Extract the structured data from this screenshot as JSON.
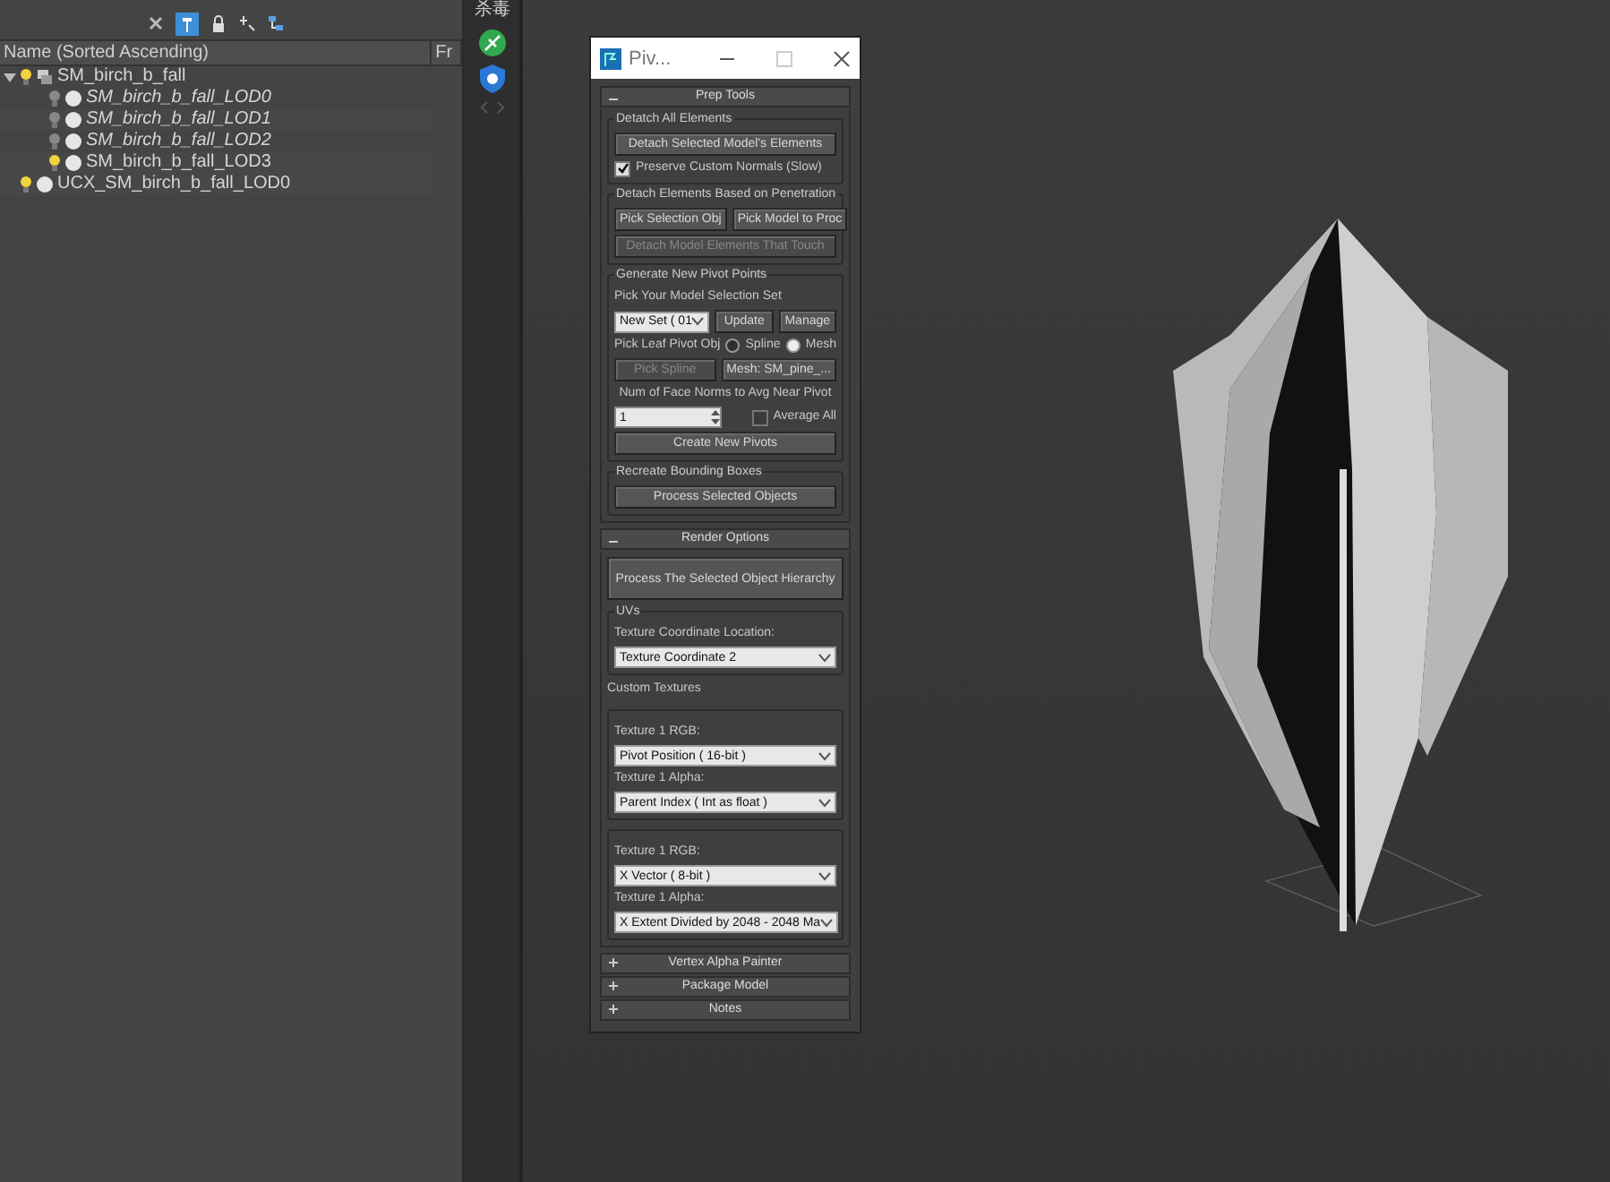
{
  "explorer": {
    "columns": [
      "Name (Sorted Ascending)",
      "Fr"
    ],
    "tree": [
      {
        "name": "SM_birch_b_fall",
        "hidden": false,
        "expanded": true,
        "children": [
          {
            "name": "SM_birch_b_fall_LOD0",
            "hidden": true
          },
          {
            "name": "SM_birch_b_fall_LOD1",
            "hidden": true
          },
          {
            "name": "SM_birch_b_fall_LOD2",
            "hidden": true
          },
          {
            "name": "SM_birch_b_fall_LOD3",
            "hidden": false
          }
        ]
      },
      {
        "name": "UCX_SM_birch_b_fall_LOD0",
        "hidden": false
      }
    ]
  },
  "side_strip": {
    "label": "杀毒"
  },
  "pivot_window": {
    "title": "Piv...",
    "rollouts": [
      {
        "title": "Prep Tools",
        "expanded": true,
        "blocks": [
          {
            "kind": "group",
            "title": "Detatch All Elements",
            "rows": [
              [
                {
                  "kind": "button",
                  "text": "Detach Selected Model's Elements"
                }
              ],
              [
                {
                  "kind": "checkbox",
                  "text": "Preserve Custom Normals (Slow)",
                  "checked": true
                }
              ]
            ]
          },
          {
            "kind": "group",
            "title": "Detach Elements Based on Penetration",
            "rows": [
              [
                {
                  "kind": "button",
                  "text": "Pick Selection Obj"
                },
                {
                  "kind": "button",
                  "text": "Pick Model to Proc"
                }
              ],
              [
                {
                  "kind": "button",
                  "text": "Detach Model Elements That Touch",
                  "disabled": true
                }
              ]
            ]
          },
          {
            "kind": "group",
            "title": "Generate New Pivot Points",
            "rows": [
              [
                {
                  "kind": "label",
                  "text": "Pick Your Model Selection Set"
                }
              ],
              [
                {
                  "kind": "dropdown",
                  "text": "New Set ( 01"
                },
                {
                  "kind": "button",
                  "text": "Update"
                },
                {
                  "kind": "button",
                  "text": "Manage"
                }
              ],
              [
                {
                  "kind": "label",
                  "text": "Pick Leaf Pivot Obj"
                },
                {
                  "kind": "radio",
                  "text": "Spline",
                  "selected": false
                },
                {
                  "kind": "radio",
                  "text": "Mesh",
                  "selected": true
                }
              ],
              [
                {
                  "kind": "button",
                  "text": "Pick Spline",
                  "disabled": true
                },
                {
                  "kind": "button",
                  "text": "Mesh: SM_pine_..."
                }
              ],
              [
                {
                  "kind": "label",
                  "text": "Num of Face Norms to Avg Near Pivot"
                }
              ],
              [
                {
                  "kind": "spinner",
                  "text": "1"
                },
                {
                  "kind": "checkbox",
                  "text": "Average All",
                  "checked": false
                }
              ],
              [
                {
                  "kind": "button",
                  "text": "Create New Pivots"
                }
              ]
            ]
          },
          {
            "kind": "group",
            "title": "Recreate Bounding Boxes",
            "rows": [
              [
                {
                  "kind": "button",
                  "text": "Process Selected Objects"
                }
              ]
            ]
          }
        ]
      },
      {
        "title": "Render Options",
        "expanded": true,
        "blocks": [
          {
            "kind": "plain",
            "rows": [
              [
                {
                  "kind": "bigbutton",
                  "text": "Process The Selected Object Hierarchy"
                }
              ]
            ]
          },
          {
            "kind": "group",
            "title": "UVs",
            "rows": [
              [
                {
                  "kind": "label",
                  "text": "Texture Coordinate Location:"
                }
              ],
              [
                {
                  "kind": "dropdown",
                  "text": "Texture Coordinate 2"
                }
              ]
            ]
          },
          {
            "kind": "plain",
            "rows": [
              [
                {
                  "kind": "label",
                  "text": "Custom Textures"
                }
              ]
            ]
          },
          {
            "kind": "group",
            "rows": [
              [
                {
                  "kind": "label",
                  "text": "Texture 1 RGB:"
                }
              ],
              [
                {
                  "kind": "dropdown",
                  "text": "Pivot Position ( 16-bit )"
                }
              ],
              [
                {
                  "kind": "label",
                  "text": "Texture 1 Alpha:"
                }
              ],
              [
                {
                  "kind": "dropdown",
                  "text": "Parent Index ( Int as float )"
                }
              ]
            ]
          },
          {
            "kind": "group",
            "rows": [
              [
                {
                  "kind": "label",
                  "text": "Texture 1 RGB:"
                }
              ],
              [
                {
                  "kind": "dropdown",
                  "text": "X Vector ( 8-bit )"
                }
              ],
              [
                {
                  "kind": "label",
                  "text": "Texture 1 Alpha:"
                }
              ],
              [
                {
                  "kind": "dropdown",
                  "text": "X Extent Divided by 2048 - 2048 Ma"
                }
              ]
            ]
          }
        ]
      },
      {
        "title": "Vertex Alpha Painter",
        "expanded": false
      },
      {
        "title": "Package Model",
        "expanded": false
      },
      {
        "title": "Notes",
        "expanded": false
      }
    ]
  }
}
